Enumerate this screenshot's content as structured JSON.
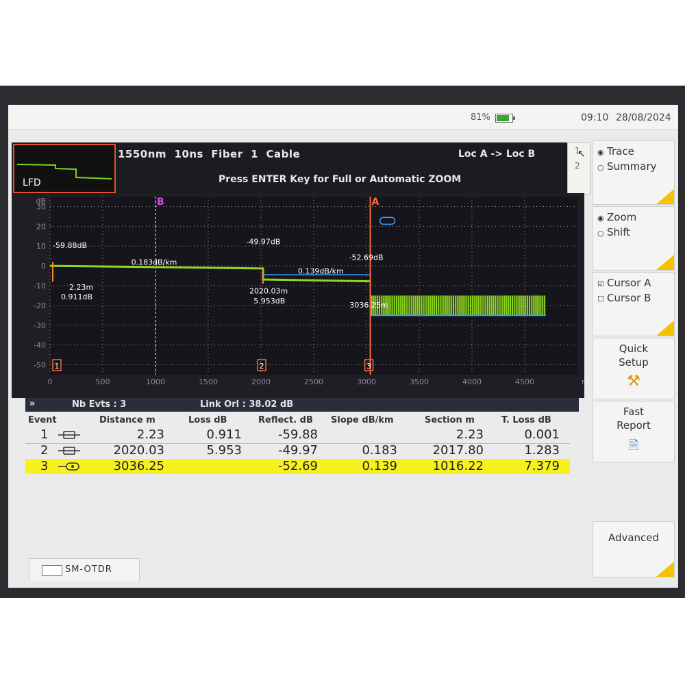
{
  "status": {
    "battery_pct": "81%",
    "time": "09:10",
    "date": "28/08/2024"
  },
  "header": {
    "thumb_label": "LFD",
    "title": "1550nm  10ns  Fiber  1  Cable",
    "loc": "Loc A -> Loc B",
    "hint": "Press ENTER Key for Full or Automatic ZOOM",
    "page_top": "1",
    "page_bottom": "2"
  },
  "chart_data": {
    "type": "line",
    "ylabel": "dB",
    "xlabel": "m",
    "xlim": [
      0,
      5000
    ],
    "ylim": [
      -55,
      35
    ],
    "xticks": [
      0,
      500,
      1000,
      1500,
      2000,
      2500,
      3000,
      3500,
      4000,
      4500
    ],
    "yticks": [
      30,
      20,
      10,
      0,
      -10,
      -20,
      -30,
      -40,
      -50
    ],
    "grid": true,
    "cursors": [
      {
        "name": "B",
        "x": 1000,
        "color": "#d84ce0"
      },
      {
        "name": "A",
        "x": 3036,
        "color": "#ff6a3a"
      }
    ],
    "trace": [
      {
        "x": 0,
        "y": 0
      },
      {
        "x": 2020,
        "y": -1.3
      },
      {
        "x": 2020,
        "y": -6.9
      },
      {
        "x": 3036,
        "y": -7.8
      },
      {
        "x": 3036,
        "y": -22
      },
      {
        "x": 4700,
        "y": -23
      }
    ],
    "annotations": {
      "refl_1": "-59.88dB",
      "slope_1": "0.183dB/km",
      "dist_1": "2.23m",
      "loss_1": "0.911dB",
      "refl_2": "-49.97dB",
      "slope_2": "0.139dB/km",
      "dist_2": "2020.03m",
      "loss_2": "5.953dB",
      "refl_3": "-52.69dB",
      "dist_3": "3036.25m"
    },
    "event_markers": [
      "1",
      "2",
      "3"
    ]
  },
  "table": {
    "nb_events": "Nb Evts : 3",
    "link_orl": "Link Orl : 38.02 dB",
    "headers": [
      "Event",
      "Distance  m",
      "Loss dB",
      "Reflect. dB",
      "Slope  dB/km",
      "Section m",
      "T. Loss dB"
    ],
    "rows": [
      {
        "event": "1",
        "distance": "2.23",
        "loss": "0.911",
        "reflect": "-59.88",
        "slope": "",
        "section": "2.23",
        "tloss": "0.001"
      },
      {
        "event": "2",
        "distance": "2020.03",
        "loss": "5.953",
        "reflect": "-49.97",
        "slope": "0.183",
        "section": "2017.80",
        "tloss": "1.283"
      },
      {
        "event": "3",
        "distance": "3036.25",
        "loss": "",
        "reflect": "-52.69",
        "slope": "0.139",
        "section": "1016.22",
        "tloss": "7.379"
      }
    ],
    "selected_row": 2
  },
  "bottom_tab": {
    "label": "SM-OTDR"
  },
  "side_panel": {
    "view_trace": "Trace",
    "view_summary": "Summary",
    "zoom": "Zoom",
    "shift": "Shift",
    "cursor_a": "Cursor A",
    "cursor_b": "Cursor B",
    "quick_setup_1": "Quick",
    "quick_setup_2": "Setup",
    "fast_report_1": "Fast",
    "fast_report_2": "Report",
    "advanced": "Advanced"
  }
}
